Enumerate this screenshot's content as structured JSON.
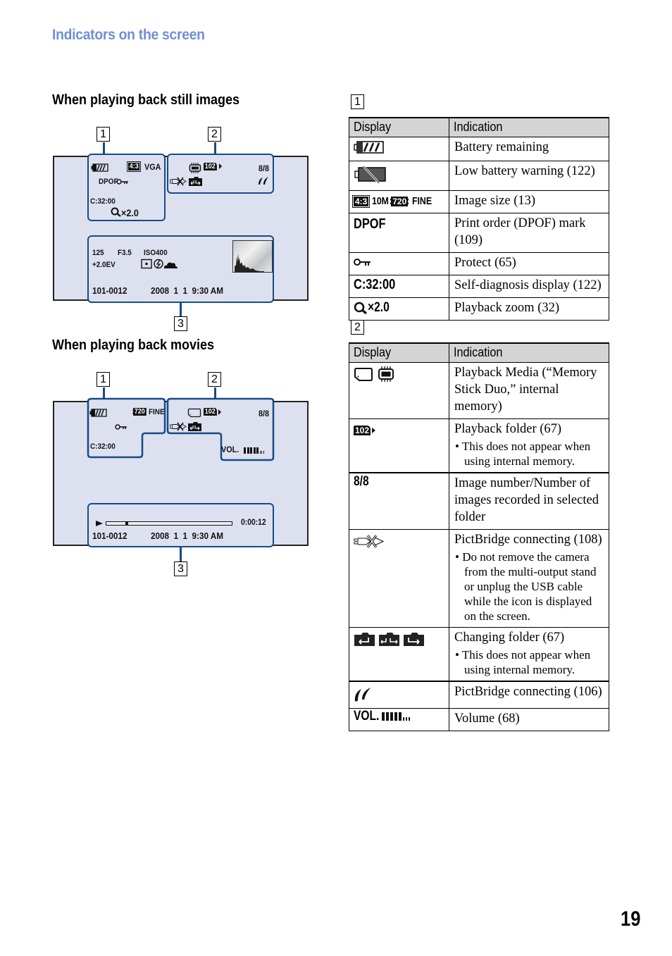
{
  "section_title": "Indicators on the screen",
  "page_number": "19",
  "still": {
    "heading": "When playing back still images",
    "callouts": [
      "1",
      "2",
      "3"
    ],
    "group1": {
      "image_size_badge": "4:3",
      "image_size": "VGA",
      "dpof": "DPOF",
      "self_diagnosis": "C:32:00",
      "zoom": "×2.0"
    },
    "group2": {
      "folder": "102",
      "image_count": "8/8"
    },
    "group3": {
      "shutter": "125",
      "aperture": "F3.5",
      "iso": "ISO400",
      "ev": "+2.0EV",
      "file_number": "101-0012",
      "date_time": "2008  1  1  9:30 AM"
    }
  },
  "movie": {
    "heading": "When playing back movies",
    "callouts": [
      "1",
      "2",
      "3"
    ],
    "group1": {
      "movie_size_badge": "720",
      "quality": "FINE",
      "self_diagnosis": "C:32:00"
    },
    "group2": {
      "folder": "102",
      "image_count": "8/8",
      "volume_label": "VOL.",
      "volume_level": 5,
      "volume_max": 8
    },
    "group3": {
      "elapsed": "0:00:12",
      "progress_fraction": 0.15,
      "file_number": "101-0012",
      "date_time": "2008  1  1  9:30 AM"
    }
  },
  "table1": {
    "label": "1",
    "headers": [
      "Display",
      "Indication"
    ],
    "rows": [
      {
        "icon": "battery-remaining-icon",
        "desc": "Battery remaining"
      },
      {
        "icon": "low-battery-icon",
        "desc": "Low battery warning (122)"
      },
      {
        "icon": "image-size-icon",
        "display_parts": [
          "4:3",
          "10M",
          "720",
          "FINE"
        ],
        "desc": "Image size (13)"
      },
      {
        "icon": "dpof-text",
        "display_text": "DPOF",
        "desc": "Print order (DPOF) mark (109)"
      },
      {
        "icon": "protect-key-icon",
        "desc": "Protect (65)"
      },
      {
        "icon": "self-diagnosis-text",
        "display_text": "C:32:00",
        "desc": "Self-diagnosis display (122)"
      },
      {
        "icon": "playback-zoom-icon",
        "display_text": "×2.0",
        "desc": "Playback zoom (32)"
      }
    ]
  },
  "table2": {
    "label": "2",
    "headers": [
      "Display",
      "Indication"
    ],
    "rows": [
      {
        "icon": "playback-media-icon",
        "desc": "Playback Media (“Memory Stick Duo,” internal memory)",
        "note": ""
      },
      {
        "icon": "playback-folder-icon",
        "display_text": "102",
        "desc": "Playback folder (67)",
        "note": "This does not appear when using internal memory."
      },
      {
        "icon": "image-number-text",
        "display_text": "8/8",
        "desc": "Image number/Number of images recorded in selected folder",
        "note": ""
      },
      {
        "icon": "pictbridge-connecting-icon",
        "desc": "PictBridge connecting (108)",
        "note": "Do not remove the camera from the multi-output stand or unplug the USB cable while the icon is displayed on the screen."
      },
      {
        "icon": "changing-folder-icon",
        "desc": "Changing folder (67)",
        "note": "This does not appear when using internal memory."
      },
      {
        "icon": "pictbridge-print-icon",
        "desc": "PictBridge connecting (106)",
        "note": ""
      },
      {
        "icon": "volume-icon",
        "display_text": "VOL.",
        "desc": "Volume (68)",
        "note": ""
      }
    ]
  },
  "colors": {
    "section_title": "#6f8fd6",
    "group_border": "#164b87",
    "screen_bg": "#dde1ef",
    "table_header_bg": "#d4d4d4"
  }
}
